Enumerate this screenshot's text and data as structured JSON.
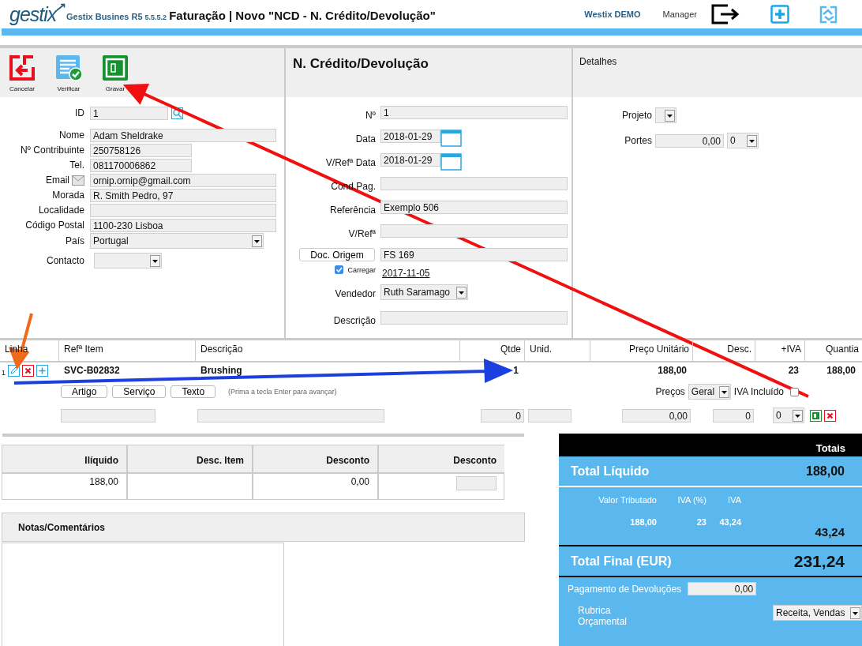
{
  "header": {
    "logo": "gestix",
    "product": "Gestix Busines R5",
    "version": "5.5.5.2",
    "title": "Faturação | Novo \"NCD - N. Crédito/Devolução\"",
    "company": "Westix DEMO",
    "user": "Manager"
  },
  "toolbar": [
    {
      "label": "Cancelar",
      "kind": "cancel"
    },
    {
      "label": "Verificar",
      "kind": "verify"
    },
    {
      "label": "Gravar",
      "kind": "save"
    }
  ],
  "customer": {
    "fields": [
      {
        "label": "ID",
        "value": "1",
        "kind": "lookup"
      },
      {
        "label": "Nome",
        "value": "Adam Sheldrake",
        "kind": "text"
      },
      {
        "label": "Nº Contribuinte",
        "value": "250758126",
        "kind": "short"
      },
      {
        "label": "Tel.",
        "value": "081170006862",
        "kind": "short"
      },
      {
        "label": "Email",
        "value": "ornip.ornip@gmail.com",
        "kind": "email"
      },
      {
        "label": "Morada",
        "value": "R. Smith Pedro, 97",
        "kind": "text"
      },
      {
        "label": "Localidade",
        "kind": "text"
      },
      {
        "label": "Código Postal",
        "value": "1100-230 Lisboa",
        "kind": "text"
      },
      {
        "label": "País",
        "value": "Portugal",
        "kind": "select"
      },
      {
        "label": "Contacto",
        "kind": "select-short"
      }
    ]
  },
  "document": {
    "title": "N. Crédito/Devolução",
    "fields": [
      {
        "label": "Nº",
        "value": "1",
        "kind": "text"
      },
      {
        "label": "Data",
        "value": "2018-01-29",
        "kind": "date"
      },
      {
        "label": "V/Refª Data",
        "value": "2018-01-29",
        "kind": "date"
      },
      {
        "label": "Cond.Pag.",
        "kind": "text"
      },
      {
        "label": "Referência",
        "value": "Exemplo 506",
        "kind": "text"
      },
      {
        "label": "V/Refª",
        "kind": "text"
      },
      {
        "kind": "origin",
        "button": "Doc. Origem",
        "value": "FS 169",
        "link": "2017-11-05",
        "checkbox_label": "Carregar",
        "checked": true
      },
      {
        "label": "Vendedor",
        "value": "Ruth Saramago",
        "kind": "select"
      },
      {
        "label": "Descrição",
        "kind": "text"
      }
    ]
  },
  "details": {
    "title": "Detalhes",
    "fields": [
      {
        "label": "Projeto",
        "kind": "select"
      },
      {
        "label": "Portes",
        "value": "0,00",
        "option": "0",
        "kind": "amount"
      }
    ]
  },
  "lines": {
    "columns": [
      {
        "label": "Linha",
        "kind": "text"
      },
      {
        "label": "Refª Item",
        "kind": "text"
      },
      {
        "label": "Descrição",
        "kind": "text"
      },
      {
        "label": "Qtde",
        "kind": "number"
      },
      {
        "label": "Unid.",
        "kind": "text"
      },
      {
        "label": "Preço Unitário",
        "kind": "number"
      },
      {
        "label": "Desc.",
        "kind": "number"
      },
      {
        "label": "+IVA",
        "kind": "number"
      },
      {
        "label": "Quantia",
        "kind": "number"
      }
    ],
    "rows": [
      {
        "cells": [
          "1",
          "SVC-B02832",
          "Brushing",
          "1",
          "",
          "188,00",
          "",
          "23",
          "188,00"
        ]
      }
    ],
    "add_buttons": [
      "Artigo",
      "Serviço",
      "Texto"
    ],
    "hint": "(Prima a tecla Enter para avançar)",
    "prices_label": "Preços",
    "prices_value": "Geral",
    "vat_included": {
      "label": "IVA Incluído",
      "checked": false
    },
    "entry": {
      "quantity": "0",
      "price": "0,00",
      "discount": "0",
      "vat": "0"
    }
  },
  "summary": {
    "columns": [
      "Ilíquido",
      "Desc. Item",
      "Desconto",
      "Desconto"
    ],
    "cells": [
      {
        "kind": "text",
        "text": "188,00"
      },
      {
        "kind": "empty"
      },
      {
        "kind": "text",
        "text": "0,00"
      },
      {
        "kind": "input"
      }
    ]
  },
  "notes": {
    "title": "Notas/Comentários"
  },
  "totals": {
    "title": "Totais",
    "net_label": "Total Líquido",
    "net": "188,00",
    "tax_columns": [
      "Valor Tributado",
      "IVA (%)",
      "IVA"
    ],
    "tax_rows": [
      [
        "188,00",
        "23",
        "43,24"
      ]
    ],
    "tax_total": "43,24",
    "final_label": "Total Final (EUR)",
    "final": "231,24",
    "refund_label": "Pagamento de Devoluções",
    "refund": "0,00",
    "budget_label": "Rubrica Orçamental",
    "budget": "Receita, Vendas"
  }
}
